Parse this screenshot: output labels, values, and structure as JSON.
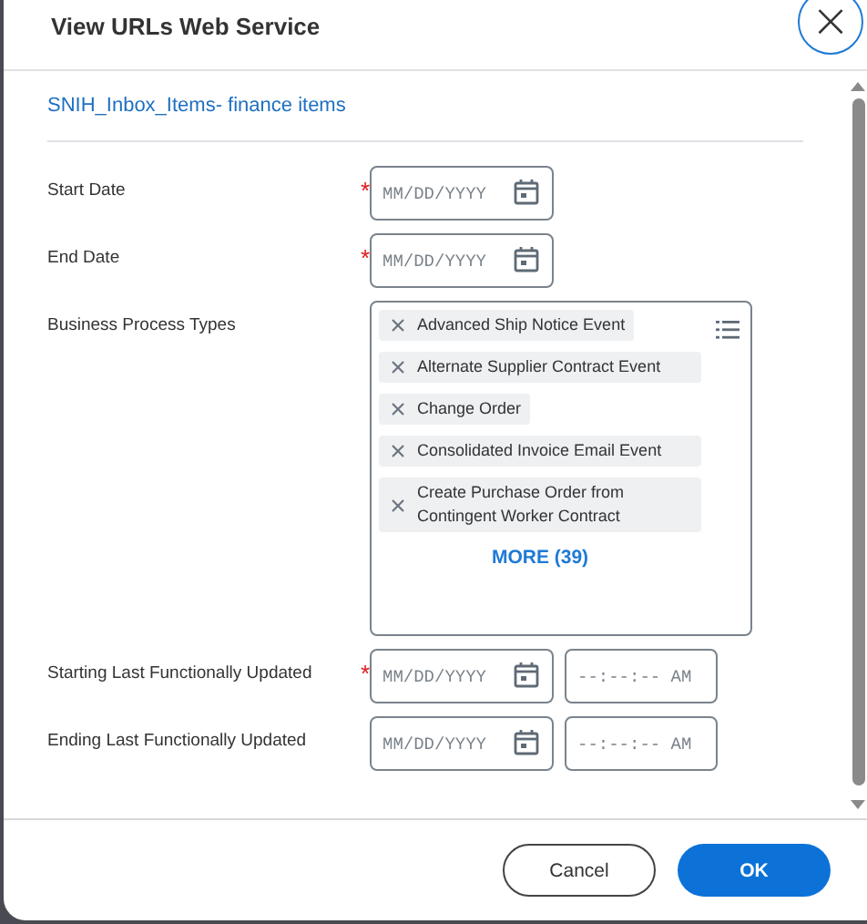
{
  "dialog": {
    "title": "View URLs Web Service",
    "close_label": "×"
  },
  "link": "SNIH_Inbox_Items- finance items",
  "required_mark": "*",
  "rows": [
    {
      "label": "Start Date",
      "required": true,
      "kind": "inputs",
      "inputs": [
        {
          "kind": "date",
          "placeholder": "MM/DD/YYYY"
        }
      ]
    },
    {
      "label": "End Date",
      "required": true,
      "kind": "inputs",
      "inputs": [
        {
          "kind": "date",
          "placeholder": "MM/DD/YYYY"
        }
      ]
    },
    {
      "label": "Business Process Types",
      "required": false,
      "kind": "multiselect",
      "chips": [
        "Advanced Ship Notice Event",
        "Alternate Supplier Contract Event",
        "Change Order",
        "Consolidated Invoice Email Event",
        "Create Purchase Order from Contingent Worker Contract"
      ],
      "more": "MORE (39)"
    },
    {
      "label": "Starting Last Functionally Updated",
      "required": true,
      "kind": "inputs",
      "inputs": [
        {
          "kind": "date",
          "placeholder": "MM/DD/YYYY"
        },
        {
          "kind": "time",
          "placeholder": "--:--:-- AM"
        }
      ]
    },
    {
      "label": "Ending Last Functionally Updated",
      "required": false,
      "kind": "inputs",
      "inputs": [
        {
          "kind": "date",
          "placeholder": "MM/DD/YYYY"
        },
        {
          "kind": "time",
          "placeholder": "--:--:-- AM"
        }
      ]
    }
  ],
  "buttons": [
    {
      "label": "Cancel",
      "kind": "secondary"
    },
    {
      "label": "OK",
      "kind": "primary"
    }
  ]
}
